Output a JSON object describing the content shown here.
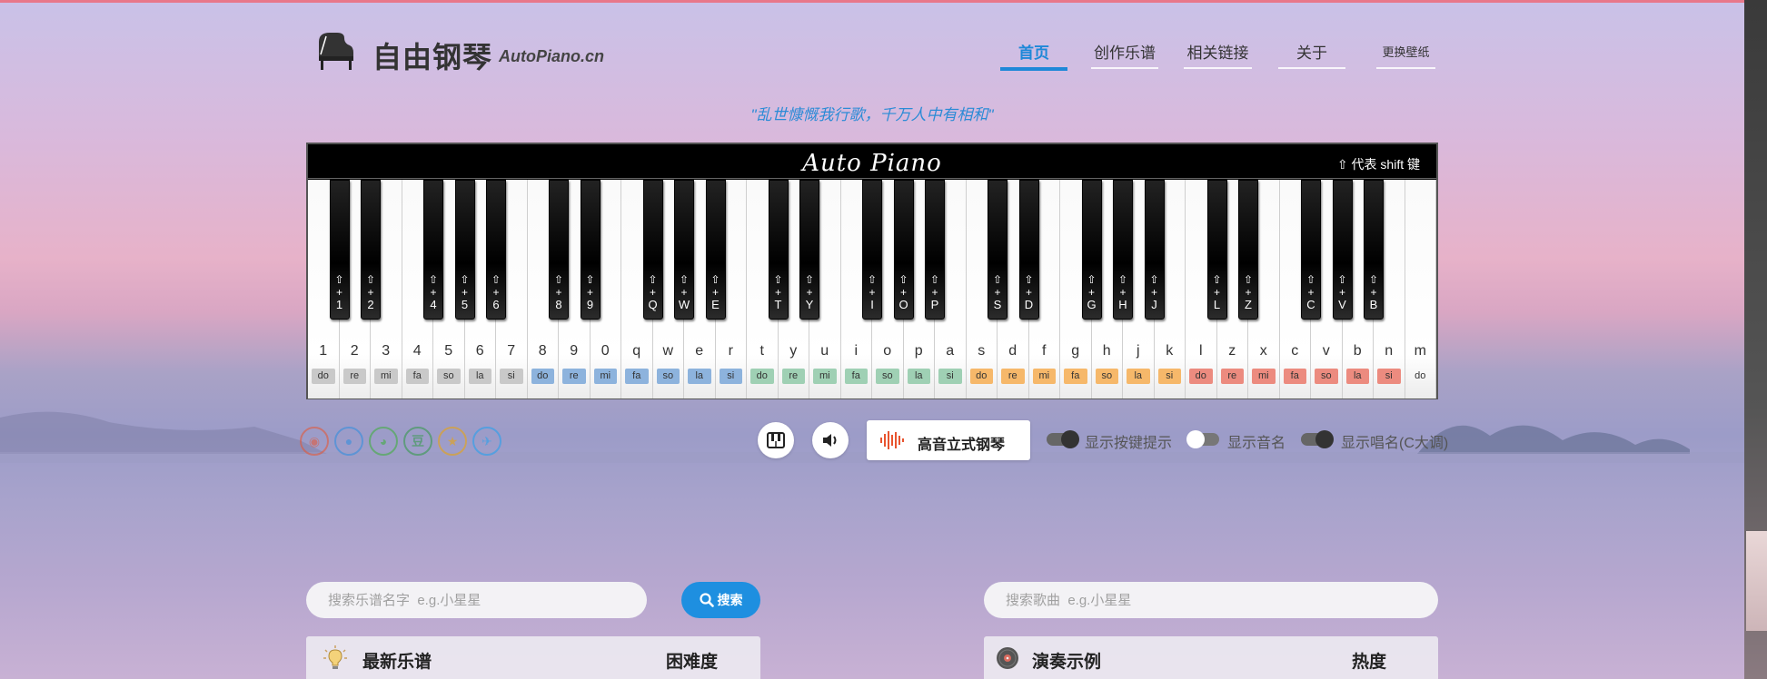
{
  "site": {
    "title": "自由钢琴",
    "subtitle": "AutoPiano.cn",
    "motto": "\"乱世慷慨我行歌，千万人中有相和\""
  },
  "nav": [
    {
      "label": "首页",
      "active": true
    },
    {
      "label": "创作乐谱",
      "active": false
    },
    {
      "label": "相关链接",
      "active": false
    },
    {
      "label": "关于",
      "active": false
    },
    {
      "label": "更换壁纸",
      "active": false
    }
  ],
  "piano": {
    "brand": "Auto Piano",
    "shift_note": "⇧ 代表 shift 键",
    "white_keys": [
      {
        "key": "1",
        "solfege": "do"
      },
      {
        "key": "2",
        "solfege": "re"
      },
      {
        "key": "3",
        "solfege": "mi"
      },
      {
        "key": "4",
        "solfege": "fa"
      },
      {
        "key": "5",
        "solfege": "so"
      },
      {
        "key": "6",
        "solfege": "la"
      },
      {
        "key": "7",
        "solfege": "si"
      },
      {
        "key": "8",
        "solfege": "do"
      },
      {
        "key": "9",
        "solfege": "re"
      },
      {
        "key": "0",
        "solfege": "mi"
      },
      {
        "key": "q",
        "solfege": "fa"
      },
      {
        "key": "w",
        "solfege": "so"
      },
      {
        "key": "e",
        "solfege": "la"
      },
      {
        "key": "r",
        "solfege": "si"
      },
      {
        "key": "t",
        "solfege": "do"
      },
      {
        "key": "y",
        "solfege": "re"
      },
      {
        "key": "u",
        "solfege": "mi"
      },
      {
        "key": "i",
        "solfege": "fa"
      },
      {
        "key": "o",
        "solfege": "so"
      },
      {
        "key": "p",
        "solfege": "la"
      },
      {
        "key": "a",
        "solfege": "si"
      },
      {
        "key": "s",
        "solfege": "do"
      },
      {
        "key": "d",
        "solfege": "re"
      },
      {
        "key": "f",
        "solfege": "mi"
      },
      {
        "key": "g",
        "solfege": "fa"
      },
      {
        "key": "h",
        "solfege": "so"
      },
      {
        "key": "j",
        "solfege": "la"
      },
      {
        "key": "k",
        "solfege": "si"
      },
      {
        "key": "l",
        "solfege": "do"
      },
      {
        "key": "z",
        "solfege": "re"
      },
      {
        "key": "x",
        "solfege": "mi"
      },
      {
        "key": "c",
        "solfege": "fa"
      },
      {
        "key": "v",
        "solfege": "so"
      },
      {
        "key": "b",
        "solfege": "la"
      },
      {
        "key": "n",
        "solfege": "si"
      },
      {
        "key": "m",
        "solfege": "do"
      }
    ],
    "octave_colors": [
      "#c9c9c9",
      "#8db3dd",
      "#9fd0b4",
      "#f6b86a",
      "#ec8b7f"
    ],
    "black_keys": [
      "1",
      "2",
      "4",
      "5",
      "6",
      "8",
      "9",
      "Q",
      "W",
      "E",
      "T",
      "Y",
      "I",
      "O",
      "P",
      "S",
      "D",
      "G",
      "H",
      "J",
      "L",
      "Z",
      "C",
      "V",
      "B"
    ],
    "black_prefix": "⇧+"
  },
  "social": [
    {
      "icon": "weibo-icon",
      "color": "#e8542f",
      "glyph": "◉"
    },
    {
      "icon": "qq-icon",
      "color": "#2c8de0",
      "glyph": "●"
    },
    {
      "icon": "wechat-icon",
      "color": "#3ab035",
      "glyph": "◕"
    },
    {
      "icon": "douban-icon",
      "color": "#2e9a43",
      "glyph": "豆"
    },
    {
      "icon": "qzone-icon",
      "color": "#f0a500",
      "glyph": "★"
    },
    {
      "icon": "twitter-icon",
      "color": "#1da1f2",
      "glyph": "✈"
    }
  ],
  "controls": {
    "instrument": "高音立式钢琴",
    "toggles": [
      {
        "label": "显示按键提示",
        "on": true
      },
      {
        "label": "显示音名",
        "on": false
      },
      {
        "label": "显示唱名(C大调)",
        "on": true
      }
    ]
  },
  "search": {
    "score_placeholder": "搜索乐谱名字  e.g.小星星",
    "button": "搜索",
    "song_placeholder": "搜索歌曲  e.g.小星星"
  },
  "panels": {
    "latest": {
      "title": "最新乐谱",
      "col": "困难度"
    },
    "demo": {
      "title": "演奏示例",
      "col": "热度"
    }
  }
}
